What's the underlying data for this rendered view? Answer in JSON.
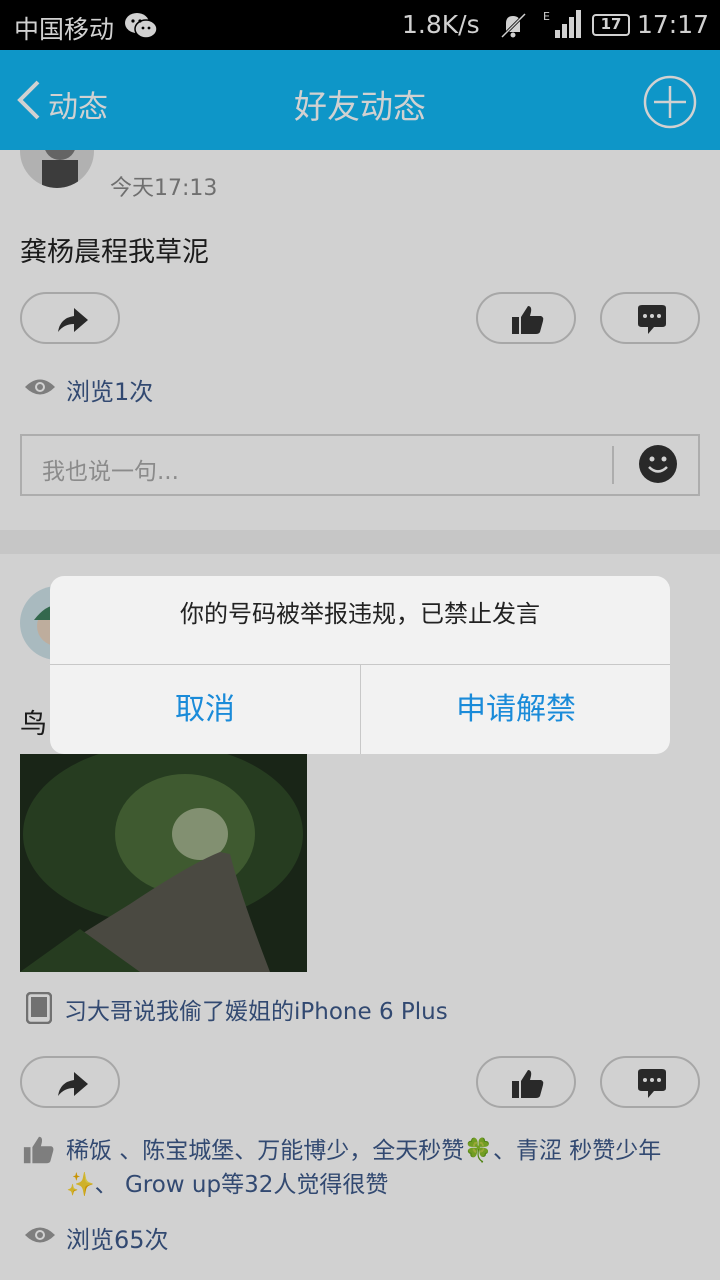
{
  "status_bar": {
    "carrier": "中国移动",
    "net_speed": "1.8K/s",
    "battery": "17",
    "time": "17:17",
    "icons": [
      "wechat-icon",
      "mute-icon",
      "signal-icon",
      "battery-icon"
    ]
  },
  "header": {
    "back_label": "动态",
    "title": "好友动态",
    "accent_color": "#12b7f5"
  },
  "posts": [
    {
      "time": "今天17:13",
      "text": "龚杨晨程我草泥",
      "views": "浏览1次",
      "comment_placeholder": "我也说一句..."
    },
    {
      "text": "鸟",
      "device": "习大哥说我偷了媛姐的iPhone 6 Plus",
      "likes": "稀饭 、陈宝城堡、万能博少，全天秒赞🍀、青涩 秒赞少年✨、 Grow up等32人觉得很赞",
      "views": "浏览65次"
    }
  ],
  "dialog": {
    "message": "你的号码被举报违规，已禁止发言",
    "cancel_label": "取消",
    "confirm_label": "申请解禁",
    "button_color": "#1a8bd9"
  }
}
